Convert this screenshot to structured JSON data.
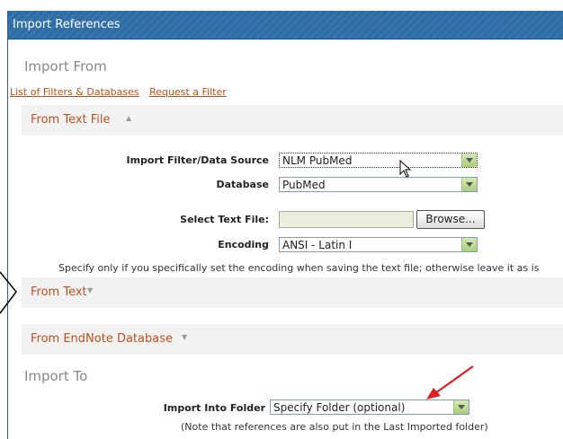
{
  "window": {
    "title": "Import References"
  },
  "import_from": {
    "heading": "Import From",
    "links": {
      "filters": "List of Filters & Databases",
      "request": "Request a Filter"
    }
  },
  "text_file_section": {
    "title": "From Text File",
    "arrow_icon": "chevron-up-icon",
    "fields": {
      "filter_label": "Import Filter/Data Source",
      "filter_value": "NLM PubMed",
      "database_label": "Database",
      "database_value": "PubMed",
      "select_file_label": "Select Text File:",
      "browse_label": "Browse...",
      "encoding_label": "Encoding",
      "encoding_value": "ANSI - Latin I"
    },
    "encoding_note": "Specify only if you specifically set the encoding when saving the text file; otherwise leave it as is"
  },
  "from_text_section": {
    "title": "From Text",
    "arrow_icon": "chevron-down-icon"
  },
  "endnote_section": {
    "title": "From EndNote Database",
    "arrow_icon": "chevron-down-icon"
  },
  "import_to": {
    "heading": "Import To",
    "folder_label": "Import Into Folder",
    "folder_value": "Specify Folder (optional)",
    "note": "(Note that references are also put in the Last Imported folder)"
  },
  "colors": {
    "titlebar": "#2f6da6",
    "link": "#c0501a",
    "annotation_arrow": "#e02020",
    "section_bg": "#f2f2f2"
  }
}
